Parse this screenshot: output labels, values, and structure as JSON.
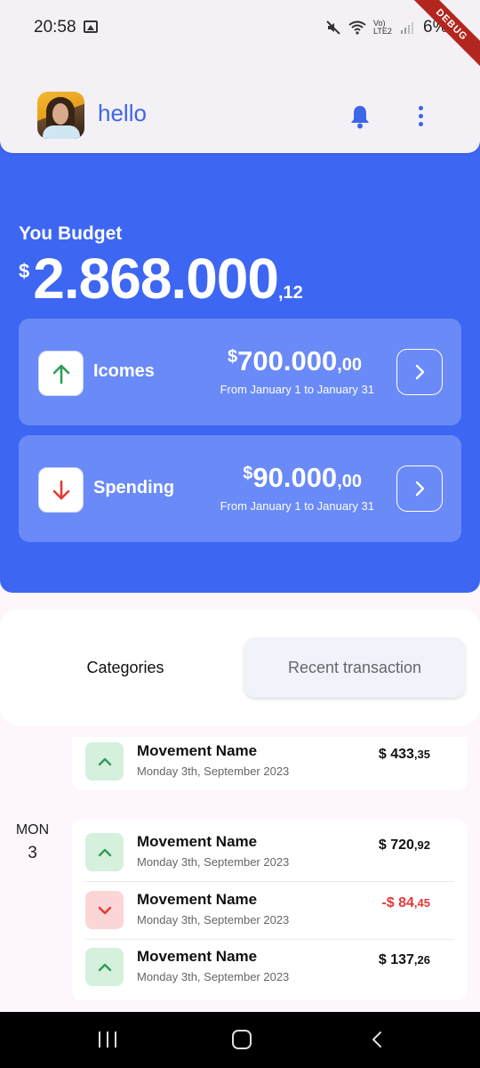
{
  "status_bar": {
    "time": "20:58",
    "network": "Vo) LTE2",
    "battery": "6%"
  },
  "debug_banner": "DEBUG",
  "app_bar": {
    "greeting": "hello",
    "icons": [
      "avatar",
      "bell-icon",
      "more-vert-icon"
    ],
    "accent_color": "#3d66e6"
  },
  "budget": {
    "label": "You Budget",
    "currency": "$",
    "amount": "2.868.000",
    "decimals": ",12",
    "panel_color": "#3d66f3"
  },
  "summary_cards": [
    {
      "label": "Icomes",
      "direction": "up",
      "currency": "$",
      "amount": "700.000",
      "decimals": ",00",
      "range": "From January 1 to January 31"
    },
    {
      "label": "Spending",
      "direction": "down",
      "currency": "$",
      "amount": "90.000",
      "decimals": ",00",
      "range": "From January 1 to January 31"
    }
  ],
  "tabs": [
    {
      "label": "Categories",
      "selected": false
    },
    {
      "label": "Recent transaction",
      "selected": true
    }
  ],
  "transactions": {
    "previous_group": [
      {
        "name": "Movement Name",
        "date": "Monday 3th,  September 2023",
        "direction": "up",
        "amount": "$ 433",
        "decimals": ",35"
      }
    ],
    "day": {
      "weekday": "MON",
      "number": "3"
    },
    "day_group": [
      {
        "name": "Movement Name",
        "date": "Monday 3th,  September 2023",
        "direction": "up",
        "amount": "$ 720",
        "decimals": ",92"
      },
      {
        "name": "Movement Name",
        "date": "Monday 3th,  September 2023",
        "direction": "down",
        "amount": "-$ 84",
        "decimals": ",45"
      },
      {
        "name": "Movement Name",
        "date": "Monday 3th,  September 2023",
        "direction": "up",
        "amount": "$ 137",
        "decimals": ",26"
      }
    ],
    "colors": {
      "income": "#2e9e57",
      "expense": "#e53935"
    }
  },
  "nav_bar": {
    "icons": [
      "recent-apps-icon",
      "home-icon",
      "back-icon"
    ]
  }
}
